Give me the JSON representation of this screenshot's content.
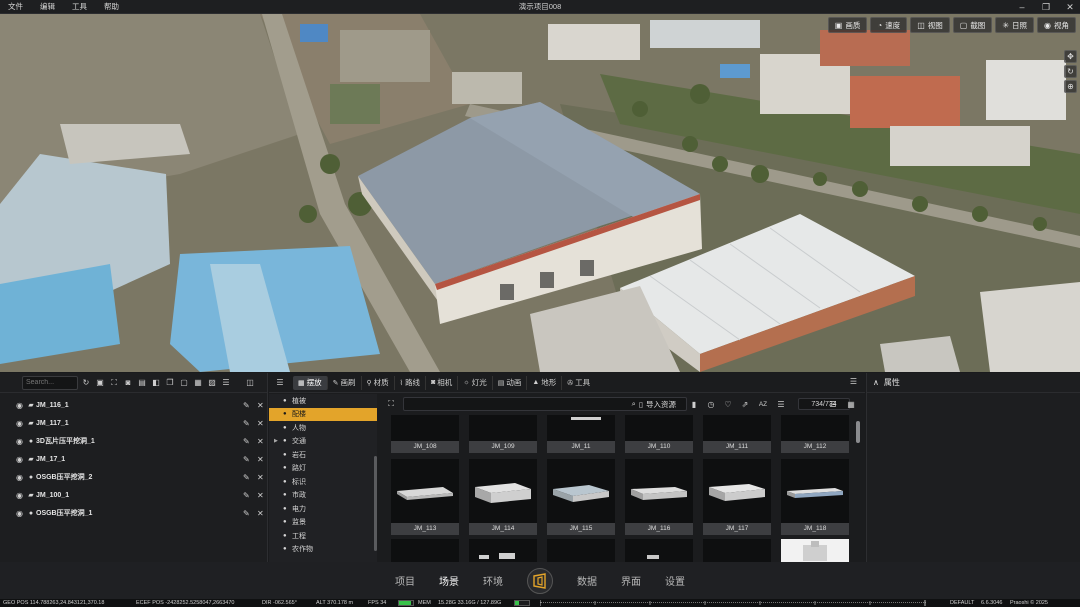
{
  "menubar": {
    "items": [
      "文件",
      "编辑",
      "工具",
      "帮助"
    ],
    "title": "演示项目008"
  },
  "viewport": {
    "toolbar": [
      {
        "icon": "picture-icon",
        "label": "画质"
      },
      {
        "icon": "speed-icon",
        "label": "速度"
      },
      {
        "icon": "view-icon",
        "label": "视图"
      },
      {
        "icon": "screenshot-icon",
        "label": "截图"
      },
      {
        "icon": "sun-icon",
        "label": "日照"
      },
      {
        "icon": "eye-icon",
        "label": "视角"
      }
    ]
  },
  "left_panel": {
    "search_placeholder": "Search...",
    "items": [
      {
        "label": "JM_116_1"
      },
      {
        "label": "JM_117_1"
      },
      {
        "label": "3D瓦片压平挖洞_1"
      },
      {
        "label": "JM_17_1"
      },
      {
        "label": "OSGB压平挖洞_2"
      },
      {
        "label": "JM_100_1"
      },
      {
        "label": "OSGB压平挖洞_1"
      }
    ]
  },
  "mid_panel": {
    "tabs": [
      {
        "label": "摆放",
        "active": true
      },
      {
        "label": "画刷",
        "active": false
      },
      {
        "label": "材质",
        "active": false
      },
      {
        "label": "路线",
        "active": false
      },
      {
        "label": "相机",
        "active": false
      },
      {
        "label": "灯光",
        "active": false
      },
      {
        "label": "动画",
        "active": false
      },
      {
        "label": "地形",
        "active": false
      },
      {
        "label": "工具",
        "active": false
      }
    ],
    "categories": [
      {
        "label": "植被",
        "active": false
      },
      {
        "label": "配楼",
        "active": true
      },
      {
        "label": "人物",
        "active": false
      },
      {
        "label": "交通",
        "active": false,
        "expandable": true
      },
      {
        "label": "岩石",
        "active": false
      },
      {
        "label": "路灯",
        "active": false
      },
      {
        "label": "标识",
        "active": false
      },
      {
        "label": "市政",
        "active": false
      },
      {
        "label": "电力",
        "active": false
      },
      {
        "label": "监景",
        "active": false
      },
      {
        "label": "工程",
        "active": false
      },
      {
        "label": "农作物",
        "active": false
      }
    ],
    "import_label": "导入资源",
    "sort_label": "AZ",
    "count": "734/734",
    "assets_row1": [
      "JM_108",
      "JM_109",
      "JM_11",
      "JM_110",
      "JM_111",
      "JM_112"
    ],
    "assets_row2": [
      "JM_113",
      "JM_114",
      "JM_115",
      "JM_116",
      "JM_117",
      "JM_118"
    ]
  },
  "right_panel": {
    "title": "属性"
  },
  "bottom_nav": {
    "items_left": [
      {
        "label": "项目",
        "active": false
      },
      {
        "label": "场景",
        "active": true
      },
      {
        "label": "环境",
        "active": false
      }
    ],
    "items_right": [
      {
        "label": "数据",
        "active": false
      },
      {
        "label": "界面",
        "active": false
      },
      {
        "label": "设置",
        "active": false
      }
    ]
  },
  "status": {
    "geo_pos": "GEO POS 114.788263,24.843121,370.18",
    "ecef_pos": "ECEF POS -2428252.5258047,2663470",
    "dir": "DIR -062.565°",
    "alt": "ALT 370.178 m",
    "fps": "FPS 34",
    "mem_label": "MEM",
    "mem_values": "15.28G 33.16G / 127.89G",
    "preset": "DEFAULT",
    "version": "6.6.3046",
    "brand": "Praoshi © 2025",
    "fps_fill": 0.85,
    "mem_fill": 0.26
  },
  "colors": {
    "accent": "#e3a42a",
    "fps_ok": "#38c24a"
  }
}
